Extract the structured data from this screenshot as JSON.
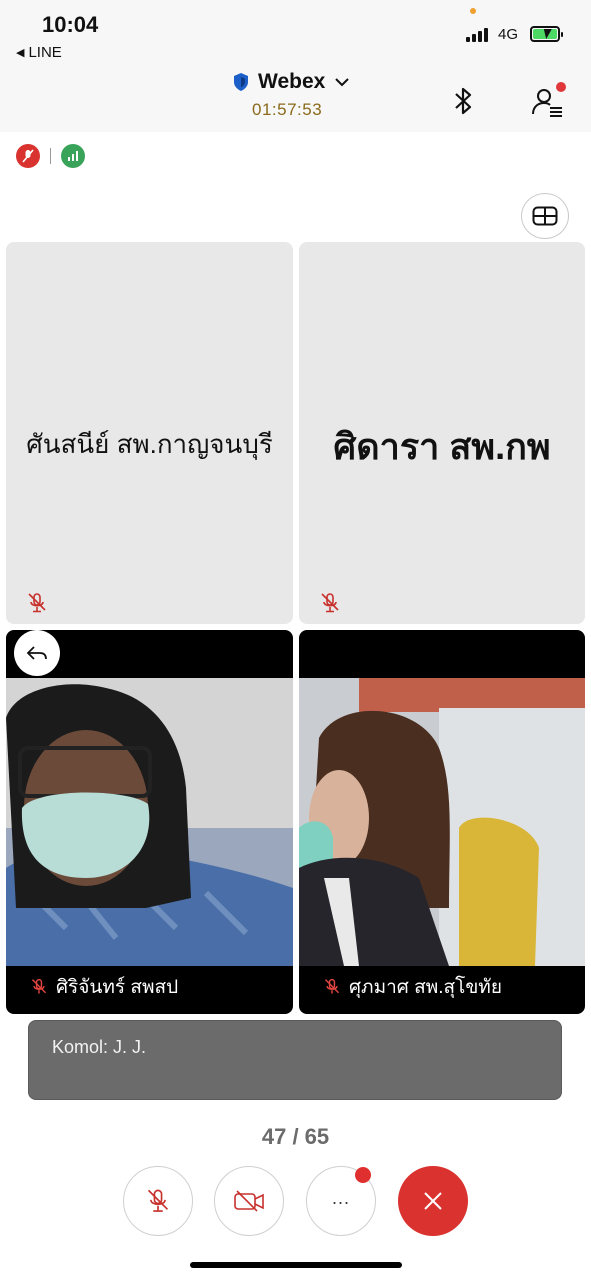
{
  "status_bar": {
    "time": "10:04",
    "back_app": "LINE",
    "network": "4G",
    "battery_state": "charging",
    "signal_bars": 4
  },
  "header": {
    "title": "Webex",
    "timer": "01:57:53",
    "icons": [
      "shield-icon",
      "chevron-down-icon",
      "bluetooth-icon",
      "participants-icon"
    ],
    "participants_badge": true
  },
  "indicators": {
    "icons": [
      "mic-muted-icon",
      "network-quality-icon"
    ],
    "colors": {
      "muted": "#d8332f",
      "network": "#3aa35a"
    }
  },
  "layout_button": {
    "icon": "grid-layout-icon"
  },
  "tiles": [
    {
      "name": "ศันสนีย์ สพ.กาญจนบุรี",
      "muted": true,
      "video": false
    },
    {
      "name": "ศิดารา สพ.กพ",
      "muted": true,
      "video": false
    },
    {
      "name": "ศิริจันทร์ สพสป",
      "muted": true,
      "video": true
    },
    {
      "name": "ศุภมาศ สพ.สุโขทัย",
      "muted": true,
      "video": true
    }
  ],
  "chat": {
    "message": "Komol: J. J."
  },
  "pagination": {
    "label": "47 / 65"
  },
  "controls": {
    "mute_icon": "mic-muted-icon",
    "video_icon": "video-off-icon",
    "more_label": "...",
    "end_icon": "close-icon",
    "colors": {
      "end": "#d9322f",
      "badge": "#e02f2f"
    }
  }
}
